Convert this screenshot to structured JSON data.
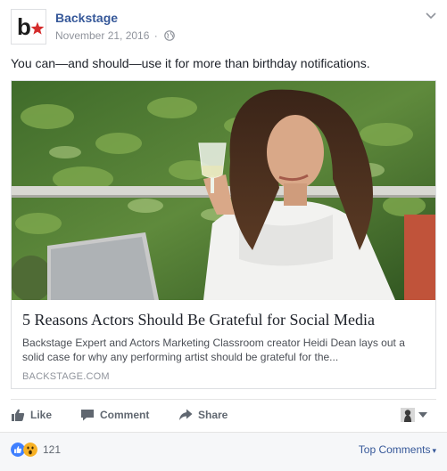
{
  "post": {
    "page_name": "Backstage",
    "date": "November 21, 2016",
    "separator": "·",
    "audience_icon": "globe-icon",
    "menu_icon": "chevron-down-icon",
    "message": "You can—and should—use it for more than birthday notifications."
  },
  "link_card": {
    "image_description_icon": "article-photo",
    "headline": "5 Reasons Actors Should Be Grateful for Social Media",
    "description": "Backstage Expert and Actors Marketing Classroom creator Heidi Dean lays out a solid case for why any performing artist should be grateful for the...",
    "domain": "BACKSTAGE.COM"
  },
  "actions": {
    "like_label": "Like",
    "comment_label": "Comment",
    "share_label": "Share"
  },
  "reactions": {
    "types": [
      "like",
      "wow"
    ],
    "count": "121",
    "sort_label": "Top Comments",
    "colors": {
      "like": "#4080ff",
      "wow": "#f7b125",
      "link": "#365899",
      "brand_red": "#d42b2b"
    }
  }
}
